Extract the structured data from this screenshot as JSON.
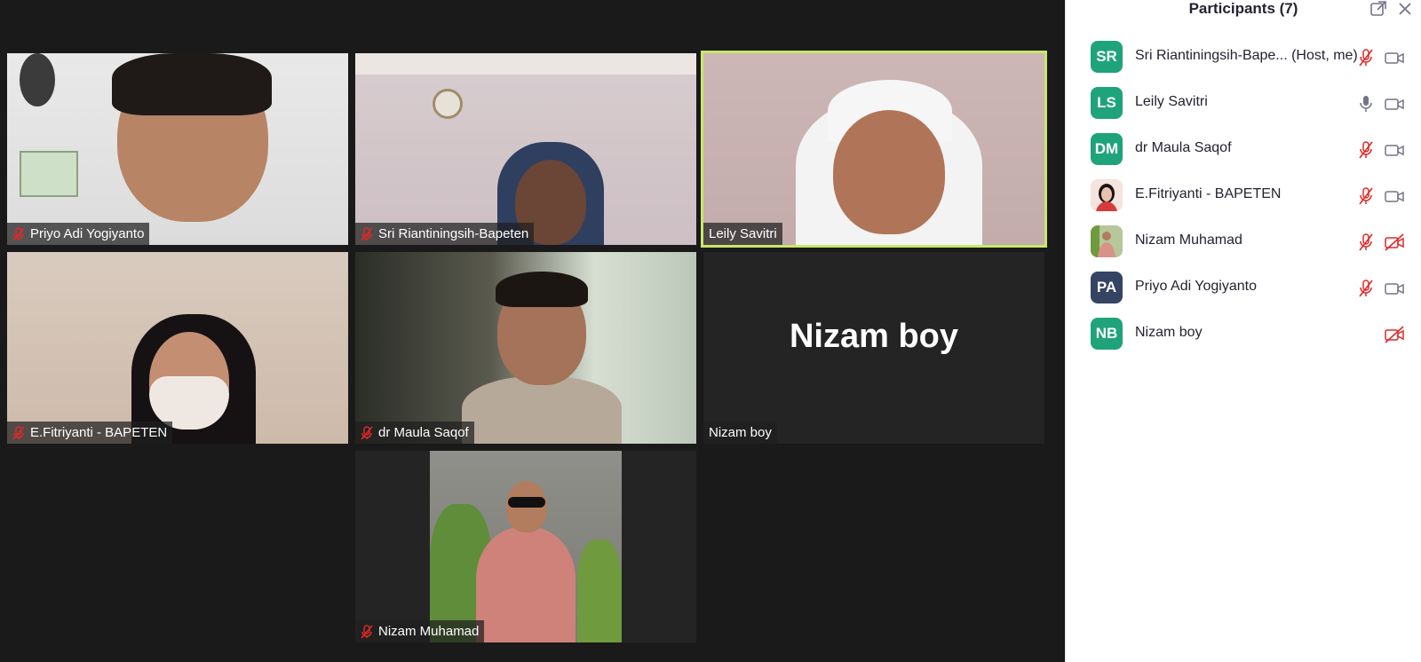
{
  "gallery": {
    "tiles": [
      {
        "name": "Priyo Adi Yogiyanto",
        "muted": true
      },
      {
        "name": "Sri Riantiningsih-Bapeten",
        "muted": true
      },
      {
        "name": "Leily Savitri",
        "muted": false,
        "active": true
      },
      {
        "name": "E.Fitriyanti - BAPETEN",
        "muted": true
      },
      {
        "name": "dr Maula Saqof",
        "muted": true
      },
      {
        "name": "Nizam boy",
        "muted": false,
        "video_off_label": "Nizam boy"
      },
      {
        "name": "Nizam Muhamad",
        "muted": true
      }
    ]
  },
  "sidebar": {
    "title": "Participants (7)",
    "participants": [
      {
        "initials": "SR",
        "name": "Sri Riantiningsih-Bape... (Host, me)",
        "avatar_color": "#1fa37a",
        "mic": "muted",
        "camera": "on"
      },
      {
        "initials": "LS",
        "name": "Leily Savitri",
        "avatar_color": "#1fa37a",
        "mic": "on",
        "camera": "on"
      },
      {
        "initials": "DM",
        "name": "dr Maula Saqof",
        "avatar_color": "#1fa37a",
        "mic": "muted",
        "camera": "on"
      },
      {
        "initials": "",
        "name": "E.Fitriyanti - BAPETEN",
        "avatar_color": "#f2d7d0",
        "mic": "muted",
        "camera": "on"
      },
      {
        "initials": "",
        "name": "Nizam Muhamad",
        "avatar_color": "#c9d3b5",
        "mic": "muted",
        "camera": "off"
      },
      {
        "initials": "PA",
        "name": "Priyo Adi Yogiyanto",
        "avatar_color": "#354463",
        "mic": "muted",
        "camera": "on"
      },
      {
        "initials": "NB",
        "name": "Nizam boy",
        "avatar_color": "#1fa37a",
        "mic": "none",
        "camera": "off"
      }
    ]
  },
  "colors": {
    "muted_red": "#e02828",
    "icon_gray": "#747487",
    "active_border": "#c8e76a"
  }
}
